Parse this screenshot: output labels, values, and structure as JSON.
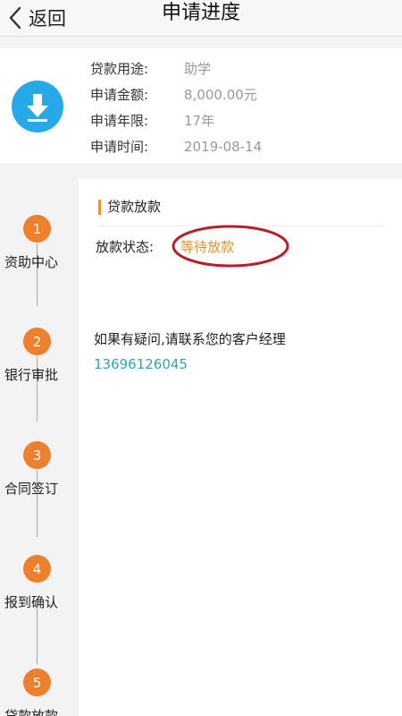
{
  "header": {
    "back_label": "返回",
    "title": "申请进度"
  },
  "info": {
    "icon": "download-icon",
    "icon_color": "#26a9e8",
    "rows": [
      {
        "label": "贷款用途:",
        "value": "助学"
      },
      {
        "label": "申请金额:",
        "value": "8,000.00元"
      },
      {
        "label": "申请年限:",
        "value": "17年"
      },
      {
        "label": "申请时间:",
        "value": "2019-08-14"
      }
    ]
  },
  "steps": [
    {
      "number": "1",
      "label": "资助中心"
    },
    {
      "number": "2",
      "label": "银行审批"
    },
    {
      "number": "3",
      "label": "合同签订"
    },
    {
      "number": "4",
      "label": "报到确认"
    },
    {
      "number": "5",
      "label": "贷款放款"
    }
  ],
  "panel": {
    "section_title": "贷款放款",
    "status_label": "放款状态:",
    "status_value": "等待放款",
    "contact_text": "如果有疑问,请联系您的客户经理",
    "phone": "13696126045"
  },
  "colors": {
    "step_accent": "#ee7f2d",
    "status": "#e3902f",
    "annotation": "#b3202a",
    "phone": "#2aa7b8"
  }
}
